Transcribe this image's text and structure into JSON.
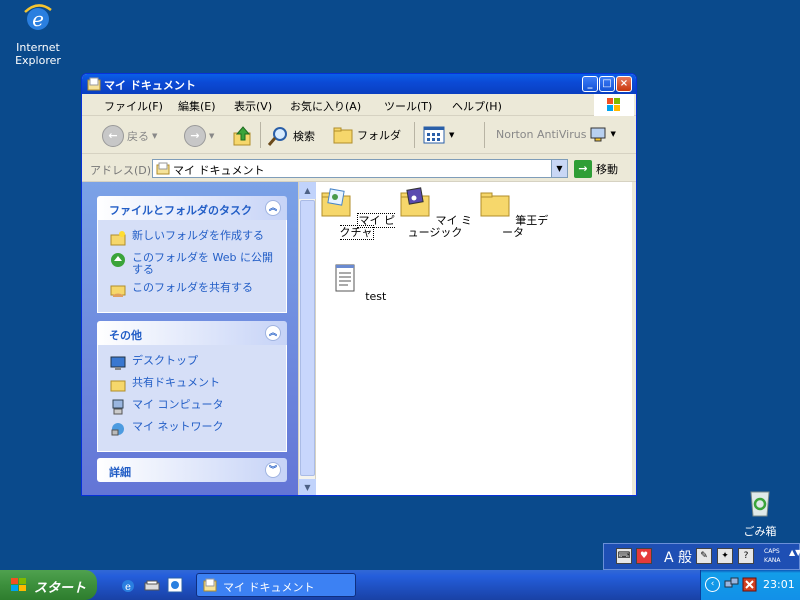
{
  "desktop": {
    "ie_label": "Internet\nExplorer",
    "ie_label_line1": "Internet",
    "ie_label_line2": "Explorer",
    "recycle_label": "ごみ箱"
  },
  "window": {
    "title": "マイ ドキュメント",
    "menu": [
      "ファイル(F)",
      "編集(E)",
      "表示(V)",
      "お気に入り(A)",
      "ツール(T)",
      "ヘルプ(H)"
    ],
    "toolbar": {
      "back": "戻る",
      "search": "検索",
      "folders": "フォルダ",
      "norton": "Norton AntiVirus"
    },
    "address": {
      "label": "アドレス(D)",
      "value": "マイ ドキュメント",
      "go": "移動"
    }
  },
  "taskpane": {
    "file_tasks": {
      "title": "ファイルとフォルダのタスク",
      "items": [
        "新しいフォルダを作成する",
        "このフォルダを Web に公開する",
        "このフォルダを共有する"
      ]
    },
    "other": {
      "title": "その他",
      "items": [
        "デスクトップ",
        "共有ドキュメント",
        "マイ コンピュータ",
        "マイ ネットワーク"
      ]
    },
    "details": {
      "title": "詳細"
    }
  },
  "files": [
    {
      "name": "マイ ピクチャ",
      "type": "pictures-folder"
    },
    {
      "name": "マイ ミュージック",
      "type": "music-folder"
    },
    {
      "name": "筆王データ",
      "type": "folder"
    },
    {
      "name": "test",
      "type": "text-file"
    }
  ],
  "langbar": {
    "mode": "A 般",
    "caps": "CAPS",
    "kana": "KANA"
  },
  "taskbar": {
    "start": "スタート",
    "task_button": "マイ ドキュメント",
    "clock": "23:01"
  },
  "colors": {
    "desktop": "#0a4a8c",
    "titlebar": "#0b4ad6",
    "taskpane_link": "#215dc6",
    "start_green": "#3c8f3c"
  }
}
